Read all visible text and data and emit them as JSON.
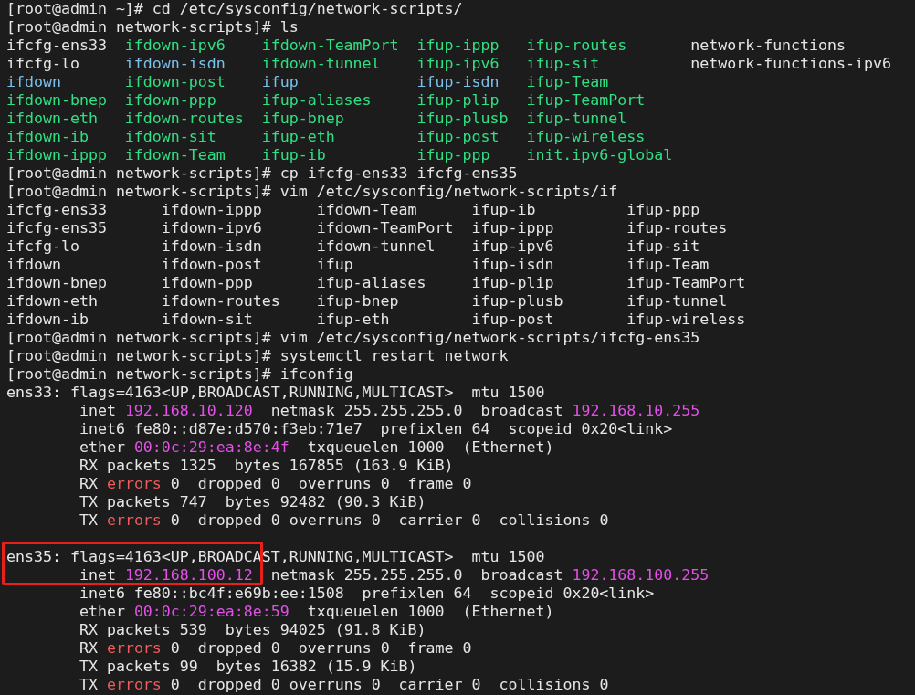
{
  "terminal": [
    {
      "kind": "command",
      "prompt": "[root@admin ~]#",
      "command": "cd /etc/sysconfig/network-scripts/"
    },
    {
      "kind": "command",
      "prompt": "[root@admin network-scripts]#",
      "command": "ls"
    },
    {
      "kind": "ls_listing",
      "rows": [
        [
          {
            "name": "ifcfg-ens33",
            "kind": "regular"
          },
          {
            "name": "ifdown-ipv6",
            "kind": "executable"
          },
          {
            "name": "ifdown-TeamPort",
            "kind": "executable"
          },
          {
            "name": "ifup-ippp",
            "kind": "executable"
          },
          {
            "name": "ifup-routes",
            "kind": "executable"
          },
          {
            "name": "network-functions",
            "kind": "regular"
          }
        ],
        [
          {
            "name": "ifcfg-lo",
            "kind": "regular"
          },
          {
            "name": "ifdown-isdn",
            "kind": "link"
          },
          {
            "name": "ifdown-tunnel",
            "kind": "executable"
          },
          {
            "name": "ifup-ipv6",
            "kind": "executable"
          },
          {
            "name": "ifup-sit",
            "kind": "executable"
          },
          {
            "name": "network-functions-ipv6",
            "kind": "regular"
          }
        ],
        [
          {
            "name": "ifdown",
            "kind": "link"
          },
          {
            "name": "ifdown-post",
            "kind": "executable"
          },
          {
            "name": "ifup",
            "kind": "link"
          },
          {
            "name": "ifup-isdn",
            "kind": "link"
          },
          {
            "name": "ifup-Team",
            "kind": "executable"
          }
        ],
        [
          {
            "name": "ifdown-bnep",
            "kind": "executable"
          },
          {
            "name": "ifdown-ppp",
            "kind": "executable"
          },
          {
            "name": "ifup-aliases",
            "kind": "executable"
          },
          {
            "name": "ifup-plip",
            "kind": "executable"
          },
          {
            "name": "ifup-TeamPort",
            "kind": "executable"
          }
        ],
        [
          {
            "name": "ifdown-eth",
            "kind": "executable"
          },
          {
            "name": "ifdown-routes",
            "kind": "executable"
          },
          {
            "name": "ifup-bnep",
            "kind": "executable"
          },
          {
            "name": "ifup-plusb",
            "kind": "executable"
          },
          {
            "name": "ifup-tunnel",
            "kind": "executable"
          }
        ],
        [
          {
            "name": "ifdown-ib",
            "kind": "executable"
          },
          {
            "name": "ifdown-sit",
            "kind": "executable"
          },
          {
            "name": "ifup-eth",
            "kind": "executable"
          },
          {
            "name": "ifup-post",
            "kind": "executable"
          },
          {
            "name": "ifup-wireless",
            "kind": "executable"
          }
        ],
        [
          {
            "name": "ifdown-ippp",
            "kind": "executable"
          },
          {
            "name": "ifdown-Team",
            "kind": "executable"
          },
          {
            "name": "ifup-ib",
            "kind": "executable"
          },
          {
            "name": "ifup-ppp",
            "kind": "executable"
          },
          {
            "name": "init.ipv6-global",
            "kind": "executable"
          }
        ]
      ]
    },
    {
      "kind": "command",
      "prompt": "[root@admin network-scripts]#",
      "command": "cp ifcfg-ens33 ifcfg-ens35"
    },
    {
      "kind": "command",
      "prompt": "[root@admin network-scripts]#",
      "command": "vim /etc/sysconfig/network-scripts/if"
    },
    {
      "kind": "completion_listing",
      "rows": [
        [
          {
            "name": "ifcfg-ens33"
          },
          {
            "name": "ifdown-ippp"
          },
          {
            "name": "ifdown-Team"
          },
          {
            "name": "ifup-ib"
          },
          {
            "name": "ifup-ppp"
          }
        ],
        [
          {
            "name": "ifcfg-ens35"
          },
          {
            "name": "ifdown-ipv6"
          },
          {
            "name": "ifdown-TeamPort"
          },
          {
            "name": "ifup-ippp"
          },
          {
            "name": "ifup-routes"
          }
        ],
        [
          {
            "name": "ifcfg-lo"
          },
          {
            "name": "ifdown-isdn"
          },
          {
            "name": "ifdown-tunnel"
          },
          {
            "name": "ifup-ipv6"
          },
          {
            "name": "ifup-sit"
          }
        ],
        [
          {
            "name": "ifdown"
          },
          {
            "name": "ifdown-post"
          },
          {
            "name": "ifup"
          },
          {
            "name": "ifup-isdn"
          },
          {
            "name": "ifup-Team"
          }
        ],
        [
          {
            "name": "ifdown-bnep"
          },
          {
            "name": "ifdown-ppp"
          },
          {
            "name": "ifup-aliases"
          },
          {
            "name": "ifup-plip"
          },
          {
            "name": "ifup-TeamPort"
          }
        ],
        [
          {
            "name": "ifdown-eth"
          },
          {
            "name": "ifdown-routes"
          },
          {
            "name": "ifup-bnep"
          },
          {
            "name": "ifup-plusb"
          },
          {
            "name": "ifup-tunnel"
          }
        ],
        [
          {
            "name": "ifdown-ib"
          },
          {
            "name": "ifdown-sit"
          },
          {
            "name": "ifup-eth"
          },
          {
            "name": "ifup-post"
          },
          {
            "name": "ifup-wireless"
          }
        ]
      ]
    },
    {
      "kind": "command",
      "prompt": "[root@admin network-scripts]#",
      "command": "vim /etc/sysconfig/network-scripts/ifcfg-ens35"
    },
    {
      "kind": "command",
      "prompt": "[root@admin network-scripts]#",
      "command": "systemctl restart network"
    },
    {
      "kind": "command",
      "prompt": "[root@admin network-scripts]#",
      "command": "ifconfig"
    },
    {
      "kind": "interface",
      "highlighted": false,
      "header": "ens33: flags=4163<UP,BROADCAST,RUNNING,MULTICAST>  mtu 1500",
      "details": [
        [
          {
            "text": "inet ",
            "kind": "text"
          },
          {
            "text": "192.168.10.120",
            "kind": "address"
          },
          {
            "text": "  netmask 255.255.255.0  broadcast ",
            "kind": "text"
          },
          {
            "text": "192.168.10.255",
            "kind": "address"
          }
        ],
        [
          {
            "text": "inet6 fe80::d87e:d570:f3eb:71e7  prefixlen 64  scopeid 0x20<link>",
            "kind": "text"
          }
        ],
        [
          {
            "text": "ether ",
            "kind": "text"
          },
          {
            "text": "00:0c:29:ea:8e:4f",
            "kind": "address"
          },
          {
            "text": "  txqueuelen 1000  (Ethernet)",
            "kind": "text"
          }
        ],
        [
          {
            "text": "RX packets 1325  bytes 167855 (163.9 KiB)",
            "kind": "text"
          }
        ],
        [
          {
            "text": "RX ",
            "kind": "text"
          },
          {
            "text": "errors",
            "kind": "error"
          },
          {
            "text": " 0  dropped 0  overruns 0  frame 0",
            "kind": "text"
          }
        ],
        [
          {
            "text": "TX packets 747  bytes 92482 (90.3 KiB)",
            "kind": "text"
          }
        ],
        [
          {
            "text": "TX ",
            "kind": "text"
          },
          {
            "text": "errors",
            "kind": "error"
          },
          {
            "text": " 0  dropped 0 overruns 0  carrier 0  collisions 0",
            "kind": "text"
          }
        ]
      ]
    },
    {
      "kind": "interface",
      "highlighted": true,
      "header": "ens35: flags=4163<UP,BROADCAST,RUNNING,MULTICAST>  mtu 1500",
      "details": [
        [
          {
            "text": "inet ",
            "kind": "text"
          },
          {
            "text": "192.168.100.12",
            "kind": "address"
          },
          {
            "text": "  netmask 255.255.255.0  broadcast ",
            "kind": "text"
          },
          {
            "text": "192.168.100.255",
            "kind": "address"
          }
        ],
        [
          {
            "text": "inet6 fe80::bc4f:e69b:ee:1508  prefixlen 64  scopeid 0x20<link>",
            "kind": "text"
          }
        ],
        [
          {
            "text": "ether ",
            "kind": "text"
          },
          {
            "text": "00:0c:29:ea:8e:59",
            "kind": "address"
          },
          {
            "text": "  txqueuelen 1000  (Ethernet)",
            "kind": "text"
          }
        ],
        [
          {
            "text": "RX packets 539  bytes 94025 (91.8 KiB)",
            "kind": "text"
          }
        ],
        [
          {
            "text": "RX ",
            "kind": "text"
          },
          {
            "text": "errors",
            "kind": "error"
          },
          {
            "text": " 0  dropped 0  overruns 0  frame 0",
            "kind": "text"
          }
        ],
        [
          {
            "text": "TX packets 99  bytes 16382 (15.9 KiB)",
            "kind": "text"
          }
        ],
        [
          {
            "text": "TX ",
            "kind": "text"
          },
          {
            "text": "errors",
            "kind": "error"
          },
          {
            "text": " 0  dropped 0 overruns 0  carrier 0  collisions 0",
            "kind": "text"
          }
        ]
      ]
    }
  ]
}
